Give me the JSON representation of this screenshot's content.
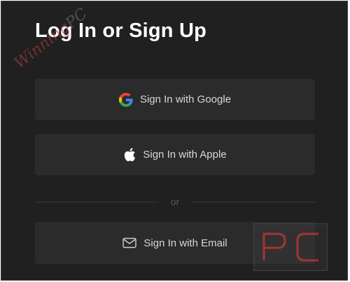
{
  "dialog": {
    "title": "Log In or Sign Up"
  },
  "buttons": {
    "google_label": "Sign In with Google",
    "apple_label": "Sign In with Apple",
    "email_label": "Sign In with Email"
  },
  "divider": {
    "text": "or"
  },
  "icons": {
    "google": "google-icon",
    "apple": "apple-icon",
    "email": "envelope-icon"
  },
  "colors": {
    "background": "#202020",
    "button_background": "#2b2b2b",
    "title_text": "#ffffff",
    "button_text": "#d8d8d8",
    "divider_text": "#555555"
  },
  "watermark": {
    "text": "WinningPC",
    "logo": "PC"
  }
}
